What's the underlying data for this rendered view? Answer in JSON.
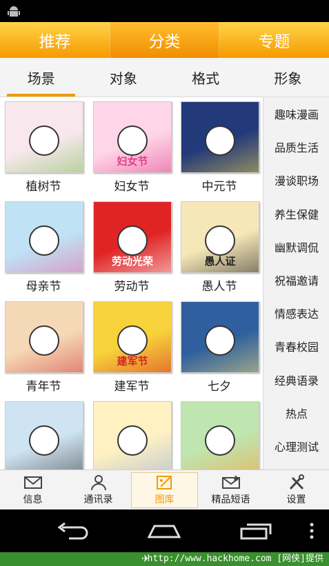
{
  "top_tabs": [
    "推荐",
    "分类",
    "专题"
  ],
  "sub_tabs": [
    "场景",
    "对象",
    "格式",
    "形象"
  ],
  "grid": [
    {
      "label": "植树节",
      "colors": [
        "#f8e8ee",
        "#7fbf5a"
      ]
    },
    {
      "label": "妇女节",
      "colors": [
        "#ffd6e8",
        "#e0408a"
      ],
      "art_text": "妇女节"
    },
    {
      "label": "中元节",
      "colors": [
        "#223a7a",
        "#f2d24a"
      ]
    },
    {
      "label": "母亲节",
      "colors": [
        "#bfe3f5",
        "#e86aa6"
      ]
    },
    {
      "label": "劳动节",
      "colors": [
        "#e02424",
        "#ffffff"
      ],
      "art_text": "劳动光荣"
    },
    {
      "label": "愚人节",
      "colors": [
        "#f6e7b8",
        "#222222"
      ],
      "art_text": "愚人证"
    },
    {
      "label": "青年节",
      "colors": [
        "#f5d9b6",
        "#d23a3a"
      ]
    },
    {
      "label": "建军节",
      "colors": [
        "#f7d23a",
        "#d22424"
      ],
      "art_text": "建军节"
    },
    {
      "label": "七夕",
      "colors": [
        "#2f5f9e",
        "#f5e27a"
      ]
    },
    {
      "label": "",
      "colors": [
        "#cfe4f2",
        "#3b3b3b"
      ]
    },
    {
      "label": "",
      "colors": [
        "#fff1c2",
        "#9ab0d8"
      ]
    },
    {
      "label": "",
      "colors": [
        "#bfe6b0",
        "#f2a23a"
      ]
    }
  ],
  "side_list": [
    "趣味漫画",
    "品质生活",
    "漫谈职场",
    "养生保健",
    "幽默调侃",
    "祝福邀请",
    "情感表达",
    "青春校园",
    "经典语录",
    "热点",
    "心理测试"
  ],
  "bottom_nav": [
    {
      "label": "信息",
      "icon": "envelope-icon"
    },
    {
      "label": "通讯录",
      "icon": "person-icon"
    },
    {
      "label": "图库",
      "icon": "image-edit-icon"
    },
    {
      "label": "精品短语",
      "icon": "star-mail-icon"
    },
    {
      "label": "设置",
      "icon": "tools-icon"
    }
  ],
  "watermark": "http://www.hackhome.com [网侠]提供",
  "colors": {
    "accent": "#f39a00",
    "watermark_bg": "#3a8f2e"
  }
}
